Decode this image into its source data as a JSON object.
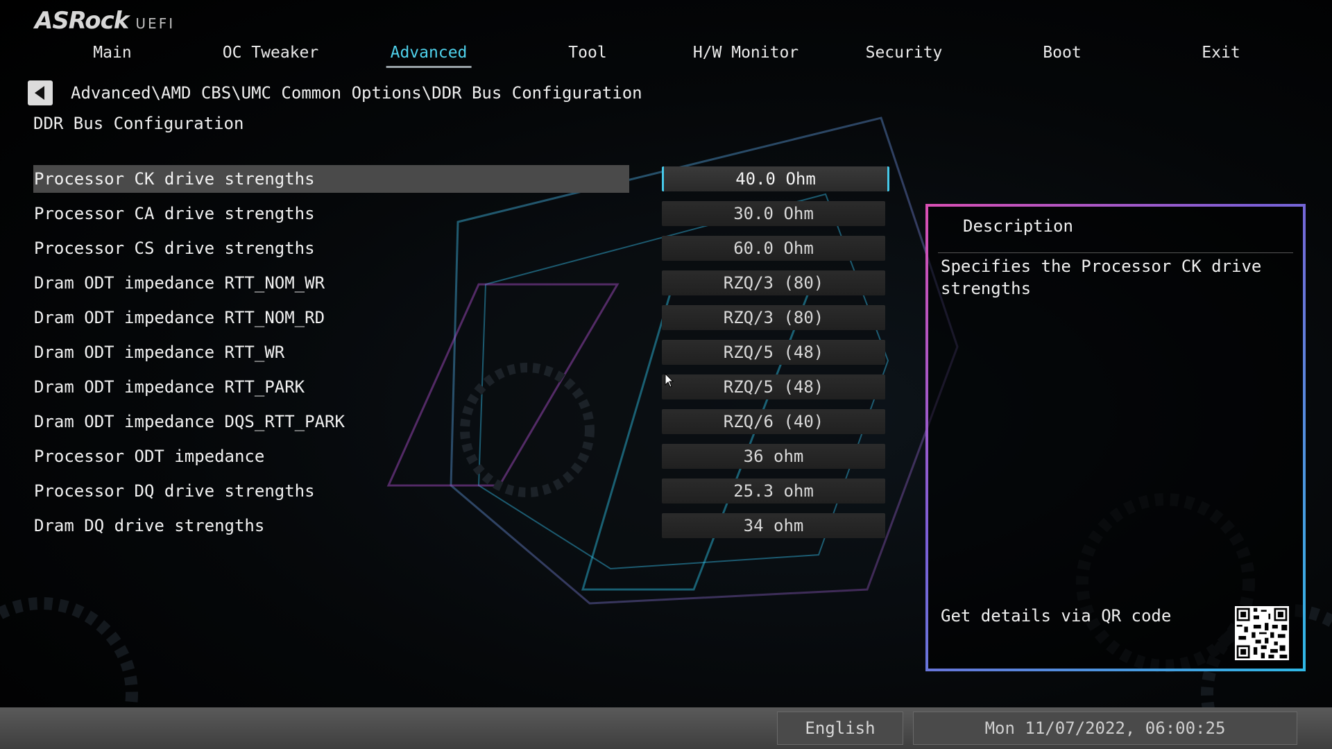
{
  "brand": {
    "logo_text": "ASRock",
    "logo_suffix": "UEFI"
  },
  "menu": {
    "tabs": [
      {
        "label": "Main",
        "active": false
      },
      {
        "label": "OC Tweaker",
        "active": false
      },
      {
        "label": "Advanced",
        "active": true
      },
      {
        "label": "Tool",
        "active": false
      },
      {
        "label": "H/W Monitor",
        "active": false
      },
      {
        "label": "Security",
        "active": false
      },
      {
        "label": "Boot",
        "active": false
      },
      {
        "label": "Exit",
        "active": false
      }
    ]
  },
  "navigation": {
    "breadcrumb": "Advanced\\AMD CBS\\UMC Common Options\\DDR Bus Configuration",
    "page_title": "DDR Bus Configuration"
  },
  "settings": [
    {
      "label": "Processor CK drive strengths",
      "value": "40.0 Ohm",
      "selected": true
    },
    {
      "label": "Processor CA drive strengths",
      "value": "30.0 Ohm",
      "selected": false
    },
    {
      "label": "Processor CS drive strengths",
      "value": "60.0 Ohm",
      "selected": false
    },
    {
      "label": "Dram ODT impedance RTT_NOM_WR",
      "value": "RZQ/3 (80)",
      "selected": false
    },
    {
      "label": "Dram ODT impedance RTT_NOM_RD",
      "value": "RZQ/3 (80)",
      "selected": false
    },
    {
      "label": "Dram ODT impedance RTT_WR",
      "value": "RZQ/5 (48)",
      "selected": false
    },
    {
      "label": "Dram ODT impedance RTT_PARK",
      "value": "RZQ/5 (48)",
      "selected": false
    },
    {
      "label": "Dram ODT impedance DQS_RTT_PARK",
      "value": "RZQ/6 (40)",
      "selected": false
    },
    {
      "label": "Processor ODT impedance",
      "value": "36 ohm",
      "selected": false
    },
    {
      "label": "Processor DQ drive strengths",
      "value": "25.3 ohm",
      "selected": false
    },
    {
      "label": "Dram DQ drive strengths",
      "value": "34 ohm",
      "selected": false
    }
  ],
  "description": {
    "title": "Description",
    "text": "Specifies the Processor CK drive strengths",
    "qr_label": "Get details via QR code"
  },
  "footer": {
    "language": "English",
    "datetime": "Mon 11/07/2022, 06:00:25"
  },
  "colors": {
    "accent": "#4fd2ec",
    "panel_border_pink": "#d94fb3",
    "panel_border_blue": "#2fb8e6",
    "selected_row": "#4a4a4a"
  },
  "icons": {
    "back": "back-arrow-icon",
    "qr": "qr-code-icon",
    "pointer": "mouse-pointer-icon"
  }
}
